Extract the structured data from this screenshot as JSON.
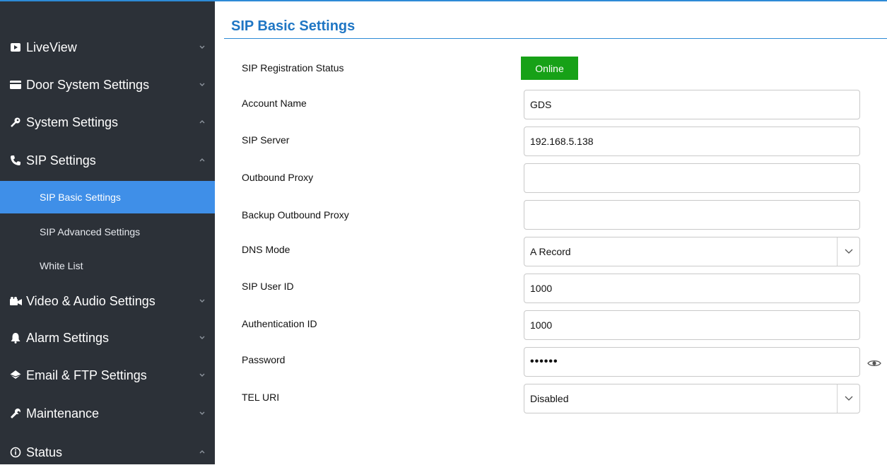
{
  "sidebar": {
    "items": [
      {
        "label": "LiveView",
        "icon": "video-icon",
        "chevron": "down"
      },
      {
        "label": "Door System Settings",
        "icon": "card-icon",
        "chevron": "down"
      },
      {
        "label": "System Settings",
        "icon": "key-icon",
        "chevron": "up"
      },
      {
        "label": "SIP Settings",
        "icon": "phone-icon",
        "chevron": "up"
      },
      {
        "label": "Video & Audio Settings",
        "icon": "camcorder-icon",
        "chevron": "down"
      },
      {
        "label": "Alarm Settings",
        "icon": "bell-icon",
        "chevron": "down"
      },
      {
        "label": "Email & FTP Settings",
        "icon": "mail-icon",
        "chevron": "down"
      },
      {
        "label": "Maintenance",
        "icon": "wrench-icon",
        "chevron": "down"
      },
      {
        "label": "Status",
        "icon": "info-icon",
        "chevron": "up"
      }
    ],
    "sip_subitems": [
      {
        "label": "SIP Basic Settings",
        "active": true
      },
      {
        "label": "SIP Advanced Settings",
        "active": false
      },
      {
        "label": "White List",
        "active": false
      }
    ]
  },
  "main": {
    "title": "SIP Basic Settings",
    "fields": {
      "registration_status": {
        "label": "SIP Registration Status",
        "value": "Online",
        "color": "#17a117"
      },
      "account_name": {
        "label": "Account Name",
        "value": "GDS"
      },
      "sip_server": {
        "label": "SIP Server",
        "value": "192.168.5.138"
      },
      "outbound_proxy": {
        "label": "Outbound Proxy",
        "value": ""
      },
      "backup_outbound_proxy": {
        "label": "Backup Outbound Proxy",
        "value": ""
      },
      "dns_mode": {
        "label": "DNS Mode",
        "value": "A Record"
      },
      "sip_user_id": {
        "label": "SIP User ID",
        "value": "1000"
      },
      "authentication_id": {
        "label": "Authentication ID",
        "value": "1000"
      },
      "password": {
        "label": "Password",
        "value": "••••••"
      },
      "tel_uri": {
        "label": "TEL URI",
        "value": "Disabled"
      }
    }
  },
  "colors": {
    "accent": "#2d8ad6",
    "sidebar_bg": "#2c3138",
    "active_bg": "#3f8fe8",
    "title": "#1f76c4"
  }
}
